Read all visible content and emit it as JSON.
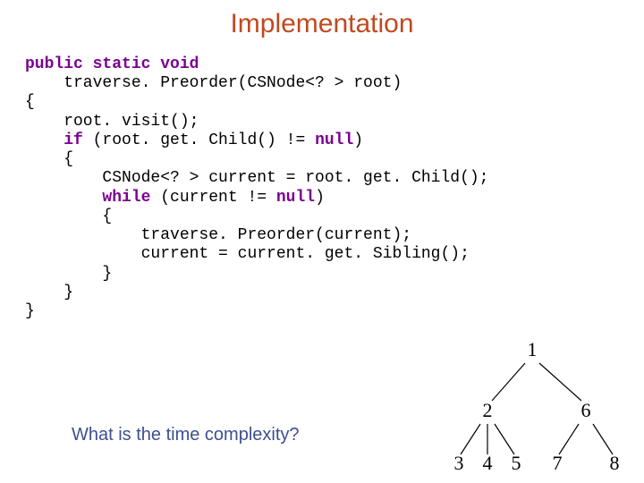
{
  "title": "Implementation",
  "question": "What is the time complexity?",
  "code": {
    "l01_public": "public",
    "l01_static": "static",
    "l01_void": "void",
    "l02": "    traverse. Preorder(CSNode<? > root)",
    "l03": "{",
    "l04": "    root. visit();",
    "l05_if": "    if",
    "l05_rest": " (root. get. Child() != ",
    "l05_null": "null",
    "l05_end": ")",
    "l06": "    {",
    "l07": "        CSNode<? > current = root. get. Child();",
    "l08_while": "        while",
    "l08_rest": " (current != ",
    "l08_null": "null",
    "l08_end": ")",
    "l09": "        {",
    "l10": "            traverse. Preorder(current);",
    "l11": "            current = current. get. Sibling();",
    "l12": "        }",
    "l13": "    }",
    "l14": "}"
  },
  "tree": {
    "n1": "1",
    "n2": "2",
    "n6": "6",
    "n3": "3",
    "n4": "4",
    "n5": "5",
    "n7": "7",
    "n8": "8"
  }
}
